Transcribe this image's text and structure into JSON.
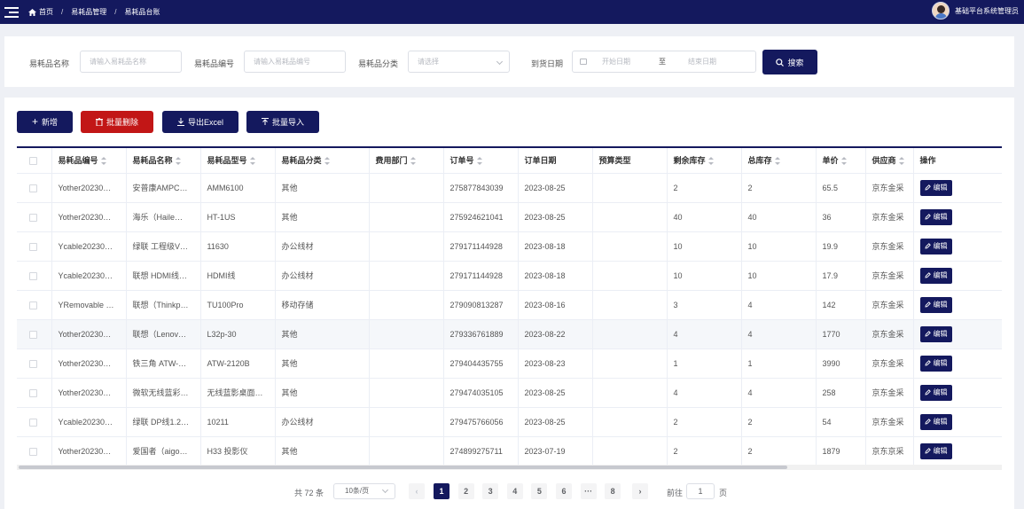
{
  "header": {
    "breadcrumbs": [
      "首页",
      "易耗品管理",
      "易耗品台账"
    ],
    "user_name": "基础平台系统管理员"
  },
  "search": {
    "name_label": "易耗品名称",
    "name_placeholder": "请输入易耗品名称",
    "code_label": "易耗品编号",
    "code_placeholder": "请输入易耗品编号",
    "category_label": "易耗品分类",
    "category_placeholder": "请选择",
    "date_label": "到货日期",
    "start_placeholder": "开始日期",
    "date_sep": "至",
    "end_placeholder": "结束日期",
    "search_button": "搜索"
  },
  "toolbar": {
    "add": "新增",
    "batch_delete": "批量删除",
    "export": "导出Excel",
    "import": "批量导入"
  },
  "table": {
    "columns": [
      "易耗品编号",
      "易耗品名称",
      "易耗品型号",
      "易耗品分类",
      "费用部门",
      "订单号",
      "订单日期",
      "预算类型",
      "剩余库存",
      "总库存",
      "单价",
      "供应商",
      "操作"
    ],
    "edit_label": "编辑",
    "rows": [
      [
        "Yother20230…",
        "安普康AMPC…",
        "AMM6100",
        "其他",
        "",
        "275877843039",
        "2023-08-25",
        "",
        "2",
        "2",
        "65.5",
        "京东金采"
      ],
      [
        "Yother20230…",
        "海乐（Haile…",
        "HT-1US",
        "其他",
        "",
        "275924621041",
        "2023-08-25",
        "",
        "40",
        "40",
        "36",
        "京东金采"
      ],
      [
        "Ycable20230…",
        "绿联 工程级V…",
        "11630",
        "办公线材",
        "",
        "279171144928",
        "2023-08-18",
        "",
        "10",
        "10",
        "19.9",
        "京东金采"
      ],
      [
        "Ycable20230…",
        "联想 HDMI线…",
        "HDMI线",
        "办公线材",
        "",
        "279171144928",
        "2023-08-18",
        "",
        "10",
        "10",
        "17.9",
        "京东金采"
      ],
      [
        "YRemovable …",
        "联想（Thinkp…",
        "TU100Pro",
        "移动存储",
        "",
        "279090813287",
        "2023-08-16",
        "",
        "3",
        "4",
        "142",
        "京东金采"
      ],
      [
        "Yother20230…",
        "联想（Lenov…",
        "L32p-30",
        "其他",
        "",
        "279336761889",
        "2023-08-22",
        "",
        "4",
        "4",
        "1770",
        "京东金采"
      ],
      [
        "Yother20230…",
        "铁三角 ATW-…",
        "ATW-2120B",
        "其他",
        "",
        "279404435755",
        "2023-08-23",
        "",
        "1",
        "1",
        "3990",
        "京东金采"
      ],
      [
        "Yother20230…",
        "微软无线蓝彩…",
        "无线蓝影桌面…",
        "其他",
        "",
        "279474035105",
        "2023-08-25",
        "",
        "4",
        "4",
        "258",
        "京东金采"
      ],
      [
        "Ycable20230…",
        "绿联 DP线1.2…",
        "10211",
        "办公线材",
        "",
        "279475766056",
        "2023-08-25",
        "",
        "2",
        "2",
        "54",
        "京东金采"
      ],
      [
        "Yother20230…",
        "爱国者（aigo…",
        "H33 投影仪",
        "其他",
        "",
        "274899275711",
        "2023-07-19",
        "",
        "2",
        "2",
        "1879",
        "京东京采"
      ]
    ]
  },
  "pagination": {
    "total": "共 72 条",
    "page_size": "10条/页",
    "pages": [
      "1",
      "2",
      "3",
      "4",
      "5",
      "6",
      "···",
      "8"
    ],
    "current": "1",
    "goto_label": "前往",
    "goto_value": "1",
    "page_suffix": "页"
  }
}
